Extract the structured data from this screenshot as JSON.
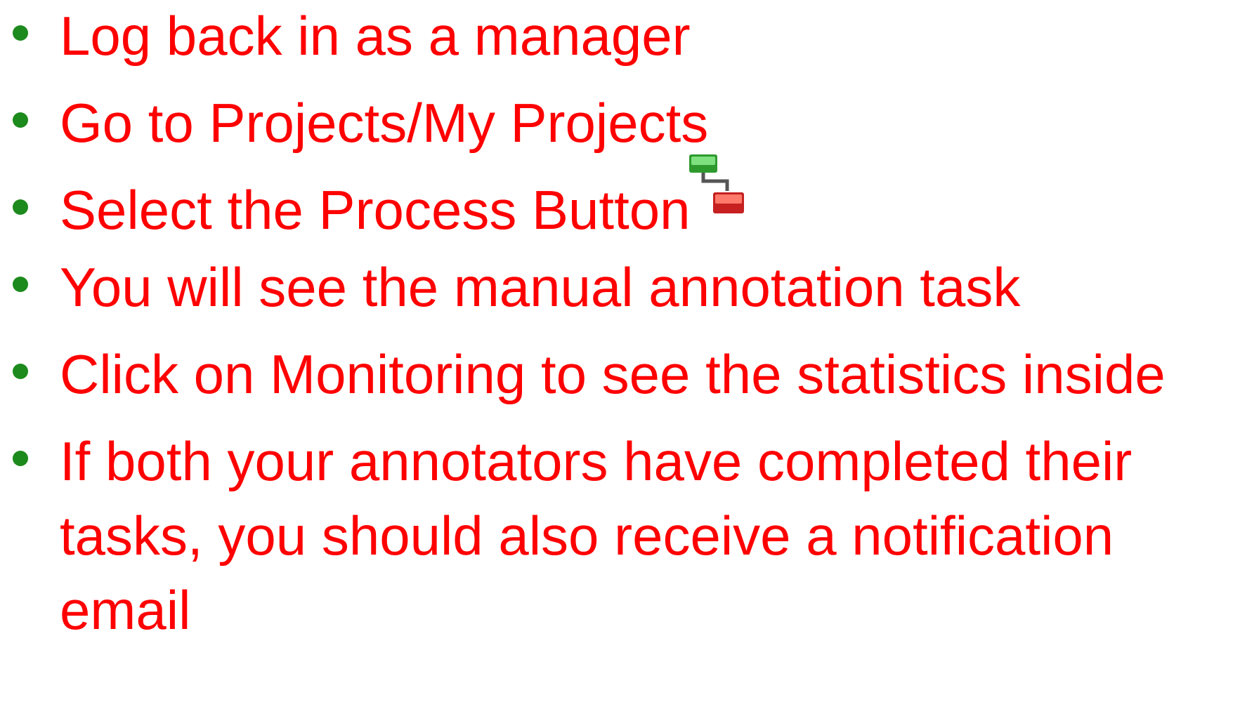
{
  "bullets": [
    {
      "text": "Log back in as a manager"
    },
    {
      "text": "Go to Projects/My Projects"
    },
    {
      "text": "Select the Process Button",
      "icon": "process-button-icon"
    },
    {
      "text": "You will see the manual annotation task"
    },
    {
      "text": "Click on Monitoring to see the statistics inside"
    },
    {
      "text": "If both your annotators have completed their tasks, you should also receive a notification email"
    }
  ],
  "colors": {
    "text": "#ff0000",
    "bullet": "#1c8a1c",
    "icon_top": "#3cb43c",
    "icon_bottom": "#e0302a",
    "icon_connector": "#555555"
  }
}
